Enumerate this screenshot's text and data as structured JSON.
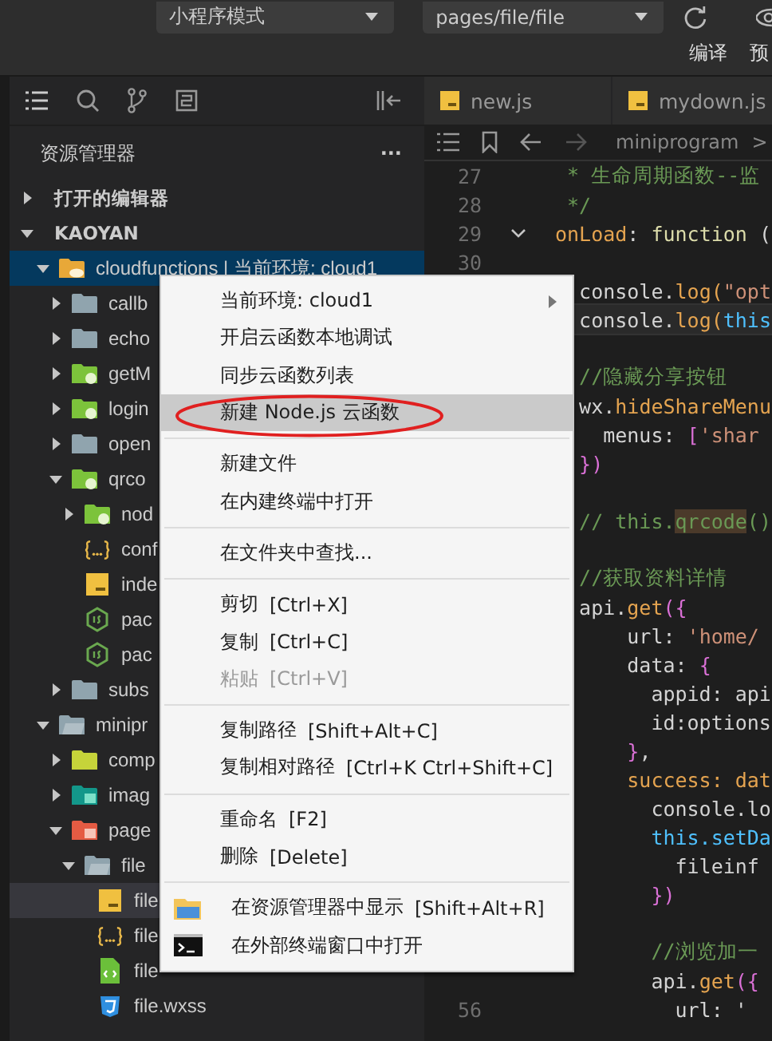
{
  "toolbar": {
    "mode": "小程序模式",
    "page": "pages/file/file",
    "actions": [
      "编译",
      "预"
    ]
  },
  "explorer": {
    "title": "资源管理器",
    "more": "···",
    "sections": [
      {
        "title": "打开的编辑器",
        "expanded": false
      },
      {
        "title": "KAOYAN",
        "expanded": true,
        "children": [
          {
            "name": "cloudfunctions | 当前环境: cloud1",
            "kind": "env-folder",
            "expanded": true,
            "selected": true,
            "children": [
              {
                "name": "callb",
                "kind": "folder",
                "expanded": false,
                "selected": false
              },
              {
                "name": "echo",
                "kind": "folder",
                "expanded": false,
                "selected": false
              },
              {
                "name": "getM",
                "kind": "cloud-folder",
                "expanded": false,
                "selected": false
              },
              {
                "name": "login",
                "kind": "cloud-folder",
                "expanded": false,
                "selected": false
              },
              {
                "name": "open",
                "kind": "folder",
                "expanded": false,
                "selected": false
              },
              {
                "name": "qrco",
                "kind": "cloud-folder",
                "expanded": true,
                "selected": false,
                "children": [
                  {
                    "name": "nod",
                    "kind": "cloud-folder",
                    "expanded": false,
                    "selected": false
                  },
                  {
                    "name": "conf",
                    "kind": "json",
                    "selected": false
                  },
                  {
                    "name": "inde",
                    "kind": "js",
                    "selected": false
                  },
                  {
                    "name": "pac",
                    "kind": "node",
                    "selected": false
                  },
                  {
                    "name": "pac",
                    "kind": "node",
                    "selected": false
                  }
                ]
              },
              {
                "name": "subs",
                "kind": "folder",
                "expanded": false,
                "selected": false
              }
            ]
          },
          {
            "name": "minipr",
            "kind": "open-folder",
            "expanded": true,
            "selected": false,
            "children": [
              {
                "name": "comp",
                "kind": "component-folder",
                "expanded": false,
                "selected": false
              },
              {
                "name": "imag",
                "kind": "image-folder",
                "expanded": false,
                "selected": false
              },
              {
                "name": "page",
                "kind": "pages-folder",
                "expanded": true,
                "selected": false,
                "children": [
                  {
                    "name": "file",
                    "kind": "open-folder",
                    "expanded": true,
                    "selected": false,
                    "children": [
                      {
                        "name": "file",
                        "kind": "js",
                        "selected": true
                      },
                      {
                        "name": "file",
                        "kind": "json",
                        "selected": false
                      },
                      {
                        "name": "file",
                        "kind": "wxml",
                        "selected": false
                      },
                      {
                        "name": "file.wxss",
                        "kind": "wxss",
                        "selected": false
                      }
                    ]
                  }
                ]
              }
            ]
          }
        ]
      }
    ]
  },
  "editor": {
    "tabs": [
      "new.js",
      "mydown.js"
    ],
    "breadcrumb": [
      "miniprogram",
      ">"
    ],
    "lines": [
      {
        "number": "27",
        "current": false,
        "fold": false,
        "tokens": [
          {
            "text": " * 生命周期函数--监",
            "kind": "comment"
          }
        ]
      },
      {
        "number": "28",
        "current": false,
        "fold": false,
        "tokens": [
          {
            "text": " */",
            "kind": "comment"
          }
        ]
      },
      {
        "number": "29",
        "current": false,
        "fold": true,
        "tokens": [
          {
            "text": "onLoad",
            "kind": "key"
          },
          {
            "text": ": ",
            "kind": "plain"
          },
          {
            "text": "function",
            "kind": "func"
          },
          {
            "text": " (",
            "kind": "plain"
          }
        ]
      },
      {
        "number": "30",
        "current": false,
        "fold": false
      },
      {
        "current": false,
        "tokens": [
          {
            "text": "  console.",
            "kind": "plain"
          },
          {
            "text": "log(",
            "kind": "key"
          },
          {
            "text": "\"opt",
            "kind": "string"
          }
        ]
      },
      {
        "current": true,
        "tokens": [
          {
            "text": "  console.",
            "kind": "plain"
          },
          {
            "text": "log(",
            "kind": "key"
          },
          {
            "text": "this",
            "kind": "prop"
          }
        ]
      },
      {
        "current": false
      },
      {
        "current": false,
        "tokens": [
          {
            "text": "  //隐藏分享按钮",
            "kind": "comment"
          }
        ]
      },
      {
        "current": false,
        "tokens": [
          {
            "text": "  wx.",
            "kind": "plain"
          },
          {
            "text": "hideShareMenu",
            "kind": "key"
          }
        ]
      },
      {
        "current": false,
        "tokens": [
          {
            "text": "    menus: ",
            "kind": "plain"
          },
          {
            "text": "[",
            "kind": "bracket"
          },
          {
            "text": "'shar",
            "kind": "string"
          }
        ]
      },
      {
        "current": false,
        "tokens": [
          {
            "text": "  })",
            "kind": "bracket"
          }
        ]
      },
      {
        "current": false
      },
      {
        "current": false,
        "tokens": [
          {
            "text": "  // this.",
            "kind": "comment"
          },
          {
            "text": "qrcode",
            "kind": "match"
          },
          {
            "text": "()",
            "kind": "comment"
          }
        ]
      },
      {
        "current": false
      },
      {
        "current": false,
        "tokens": [
          {
            "text": "  //获取资料详情",
            "kind": "comment"
          }
        ]
      },
      {
        "current": false,
        "tokens": [
          {
            "text": "  api.",
            "kind": "plain"
          },
          {
            "text": "get",
            "kind": "key"
          },
          {
            "text": "({",
            "kind": "bracket"
          }
        ]
      },
      {
        "current": false,
        "tokens": [
          {
            "text": "      url: ",
            "kind": "plain"
          },
          {
            "text": "'home/",
            "kind": "string"
          }
        ]
      },
      {
        "current": false,
        "tokens": [
          {
            "text": "      data: ",
            "kind": "plain"
          },
          {
            "text": "{",
            "kind": "bracket"
          }
        ]
      },
      {
        "current": false,
        "tokens": [
          {
            "text": "        appid: api",
            "kind": "plain"
          }
        ]
      },
      {
        "current": false,
        "tokens": [
          {
            "text": "        id:options",
            "kind": "plain"
          }
        ]
      },
      {
        "current": false,
        "tokens": [
          {
            "text": "      }",
            "kind": "bracket"
          },
          {
            "text": ",",
            "kind": "plain"
          }
        ]
      },
      {
        "current": false,
        "tokens": [
          {
            "text": "      success: dat",
            "kind": "key"
          }
        ]
      },
      {
        "current": false,
        "tokens": [
          {
            "text": "        console.lo",
            "kind": "plain"
          }
        ]
      },
      {
        "current": false,
        "tokens": [
          {
            "text": "        this.setDa",
            "kind": "prop"
          }
        ]
      },
      {
        "current": false,
        "tokens": [
          {
            "text": "          fileinf",
            "kind": "plain"
          }
        ]
      },
      {
        "current": false,
        "tokens": [
          {
            "text": "        })",
            "kind": "bracket"
          }
        ]
      },
      {
        "current": false
      },
      {
        "current": false,
        "tokens": [
          {
            "text": "        //浏览加一",
            "kind": "comment"
          }
        ]
      },
      {
        "current": false,
        "tokens": [
          {
            "text": "        api.",
            "kind": "plain"
          },
          {
            "text": "get",
            "kind": "key"
          },
          {
            "text": "({",
            "kind": "bracket"
          }
        ]
      },
      {
        "number": "56",
        "current": false,
        "fold": false,
        "tokens": [
          {
            "text": "          url: '",
            "kind": "plain"
          }
        ]
      }
    ]
  },
  "context_menu": [
    {
      "kind": "item",
      "label": "当前环境: cloud1",
      "submenu": true,
      "disabled": false,
      "selected": false,
      "circled": false
    },
    {
      "kind": "item",
      "label": "开启云函数本地调试",
      "submenu": false,
      "disabled": false,
      "selected": false,
      "circled": false
    },
    {
      "kind": "item",
      "label": "同步云函数列表",
      "submenu": false,
      "disabled": false,
      "selected": false,
      "circled": false
    },
    {
      "kind": "item",
      "label": "新建 Node.js 云函数",
      "submenu": false,
      "disabled": false,
      "selected": true,
      "circled": true
    },
    {
      "kind": "separator"
    },
    {
      "kind": "item",
      "label": "新建文件",
      "submenu": false,
      "disabled": false,
      "selected": false,
      "circled": false
    },
    {
      "kind": "item",
      "label": "在内建终端中打开",
      "submenu": false,
      "disabled": false,
      "selected": false,
      "circled": false
    },
    {
      "kind": "separator"
    },
    {
      "kind": "item",
      "label": "在文件夹中查找...",
      "submenu": false,
      "disabled": false,
      "selected": false,
      "circled": false
    },
    {
      "kind": "separator"
    },
    {
      "kind": "item",
      "label": "剪切",
      "shortcut": "[Ctrl+X]",
      "submenu": false,
      "disabled": false,
      "selected": false,
      "circled": false
    },
    {
      "kind": "item",
      "label": "复制",
      "shortcut": "[Ctrl+C]",
      "submenu": false,
      "disabled": false,
      "selected": false,
      "circled": false
    },
    {
      "kind": "item",
      "label": "粘贴",
      "shortcut": "[Ctrl+V]",
      "submenu": false,
      "disabled": true,
      "selected": false,
      "circled": false
    },
    {
      "kind": "separator"
    },
    {
      "kind": "item",
      "label": "复制路径",
      "shortcut": "[Shift+Alt+C]",
      "submenu": false,
      "disabled": false,
      "selected": false,
      "circled": false
    },
    {
      "kind": "item",
      "label": "复制相对路径",
      "shortcut": "[Ctrl+K Ctrl+Shift+C]",
      "submenu": false,
      "disabled": false,
      "selected": false,
      "circled": false
    },
    {
      "kind": "separator"
    },
    {
      "kind": "item",
      "label": "重命名",
      "shortcut": "[F2]",
      "submenu": false,
      "disabled": false,
      "selected": false,
      "circled": false
    },
    {
      "kind": "item",
      "label": "删除",
      "shortcut": "[Delete]",
      "submenu": false,
      "disabled": false,
      "selected": false,
      "circled": false
    },
    {
      "kind": "separator"
    },
    {
      "kind": "explorer",
      "label": "在资源管理器中显示",
      "shortcut": "[Shift+Alt+R]",
      "submenu": false,
      "disabled": false,
      "selected": false,
      "circled": false
    },
    {
      "kind": "terminal",
      "label": "在外部终端窗口中打开",
      "submenu": false,
      "disabled": false,
      "selected": false,
      "circled": false
    }
  ]
}
